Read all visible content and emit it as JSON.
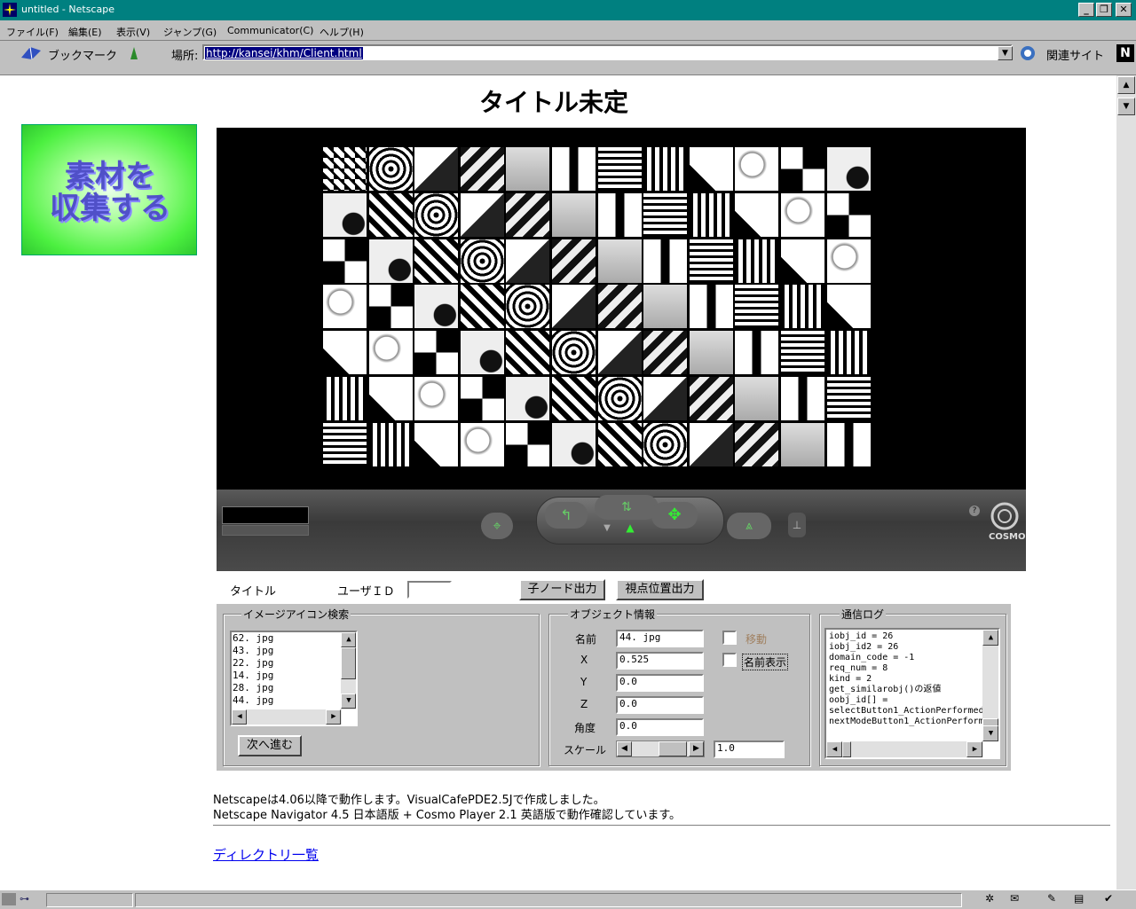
{
  "window": {
    "title": "untitled - Netscape"
  },
  "menu": {
    "items": [
      "ファイル(F)",
      "編集(E)",
      "表示(V)",
      "ジャンプ(G)",
      "Communicator(C)",
      "ヘルプ(H)"
    ]
  },
  "toolbar": {
    "bookmarks": "ブックマーク",
    "location_label": "場所:",
    "url": "http://kansei/khm/Client.html",
    "related": "関連サイト"
  },
  "page": {
    "title": "タイトル未定",
    "collect_button": [
      "素材を",
      "収集する"
    ],
    "form": {
      "title_label": "タイトル",
      "user_id_label": "ユーザＩＤ",
      "user_id_value": "",
      "child_node_button": "子ノード出力",
      "viewpoint_button": "視点位置出力"
    },
    "image_search": {
      "group_title": "イメージアイコン検索",
      "items": [
        "62. jpg",
        "43. jpg",
        "22. jpg",
        "14. jpg",
        "28. jpg",
        "44. jpg"
      ],
      "next_button": "次へ進む"
    },
    "object_info": {
      "group_title": "オブジェクト情報",
      "name_label": "名前",
      "name_value": "44. jpg",
      "x_label": "X",
      "x_value": "0.525",
      "y_label": "Y",
      "y_value": "0.0",
      "z_label": "Z",
      "z_value": "0.0",
      "angle_label": "角度",
      "angle_value": "0.0",
      "scale_label": "スケール",
      "scale_value": "1.0",
      "move_label": "移動",
      "show_name_label": "名前表示"
    },
    "comm_log": {
      "group_title": "通信ログ",
      "lines": [
        "iobj_id = 26",
        "iobj_id2 = 26",
        "domain_code = -1",
        "req_num = 8",
        "kind = 2",
        "get_similarobj()の返値",
        "oobj_id[] =",
        "selectButton1_ActionPerformed",
        "nextModeButton1_ActionPerform"
      ]
    },
    "notes": [
      "Netscapeは4.06以降で動作します。VisualCafePDE2.5Jで作成しました。",
      "Netscape Navigator 4.5 日本語版 + Cosmo Player 2.1 英語版で動作確認しています。"
    ],
    "directory_link": "ディレクトリ一覧"
  },
  "cosmo": {
    "brand": "COSMO"
  }
}
